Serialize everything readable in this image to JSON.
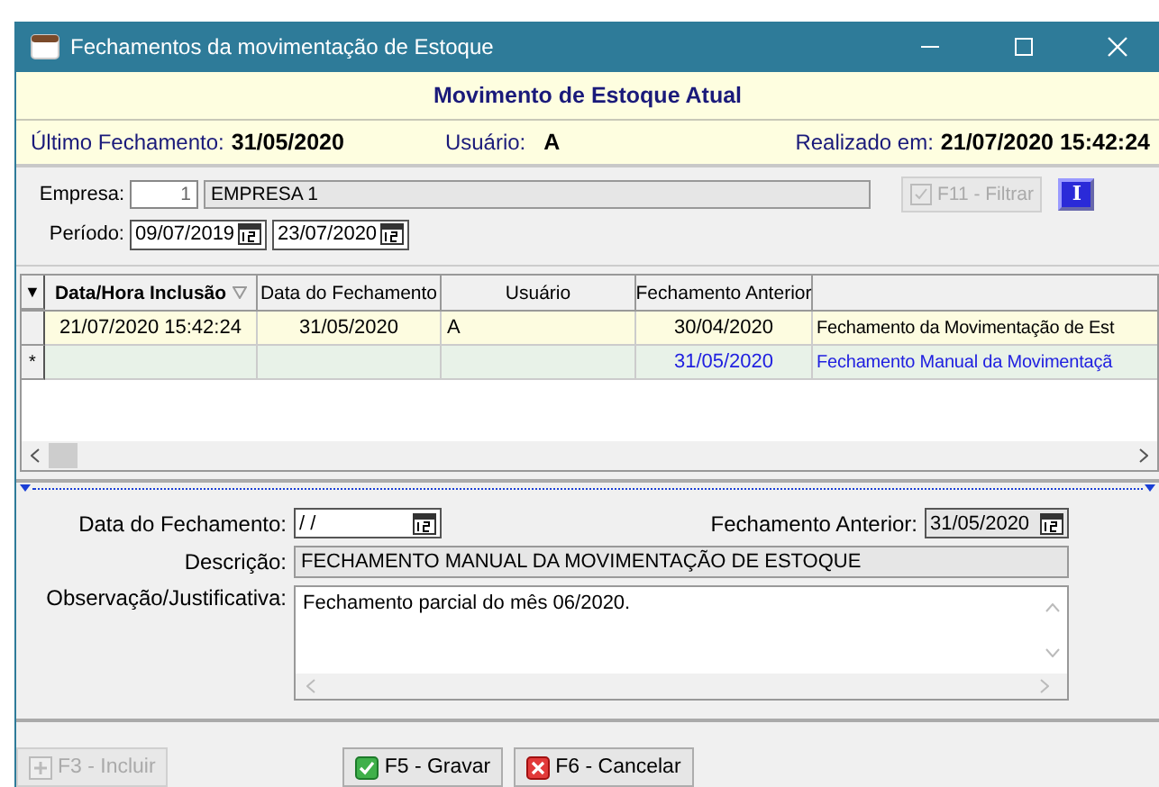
{
  "window": {
    "title": "Fechamentos da movimentação de Estoque"
  },
  "header": {
    "title": "Movimento de Estoque Atual"
  },
  "info": {
    "last_closing_label": "Último Fechamento:",
    "last_closing": "31/05/2020",
    "user_label": "Usuário:",
    "user": "A",
    "done_label": "Realizado em:",
    "done": "21/07/2020 15:42:24"
  },
  "filter": {
    "company_label": "Empresa:",
    "company_code": "1",
    "company_name": "EMPRESA 1",
    "period_label": "Período:",
    "period_from": "09/07/2019",
    "period_to": "23/07/2020",
    "filter_button": {
      "label": "F11 - Filtrar",
      "disabled": true
    },
    "info_button": "I"
  },
  "grid": {
    "header_marker": "▼",
    "columns": [
      {
        "label": "Data/Hora Inclusão",
        "sorted": true
      },
      {
        "label": "Data do Fechamento",
        "sorted": false
      },
      {
        "label": "Usuário",
        "sorted": false
      },
      {
        "label": "Fechamento Anterior",
        "sorted": false
      }
    ],
    "rows": [
      {
        "kind": "record",
        "marker": "",
        "cells": [
          "21/07/2020 15:42:24",
          "31/05/2020",
          "A",
          "30/04/2020",
          "Fechamento da Movimentação de Est"
        ]
      },
      {
        "kind": "new",
        "marker": "*",
        "cells": [
          "",
          "",
          "",
          "31/05/2020",
          "Fechamento Manual da Movimentaçã"
        ]
      }
    ]
  },
  "form": {
    "date_label": "Data do Fechamento:",
    "date_value": "/ /",
    "previous_label": "Fechamento Anterior:",
    "previous_value": "31/05/2020",
    "description_label": "Descrição:",
    "description_value": "FECHAMENTO MANUAL DA MOVIMENTAÇÃO DE ESTOQUE",
    "notes_label": "Observação/Justificativa:",
    "notes_value": "Fechamento parcial do mês 06/2020."
  },
  "buttons": [
    {
      "kind": "add",
      "label": "F3 - Incluir",
      "disabled": true
    },
    {
      "kind": "save",
      "label": "F5 - Gravar",
      "disabled": false
    },
    {
      "kind": "cancel",
      "label": "F6 - Cancelar",
      "disabled": false
    }
  ]
}
